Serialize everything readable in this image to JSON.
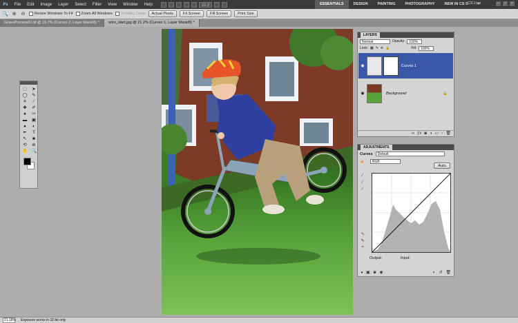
{
  "app": {
    "logo": "Ps",
    "menu": [
      "File",
      "Edit",
      "Image",
      "Layer",
      "Select",
      "Filter",
      "View",
      "Window",
      "Help"
    ],
    "zoom_select": "21.2",
    "workspaces": [
      "ESSENTIALS",
      "DESIGN",
      "PAINTING",
      "PHOTOGRAPHY",
      "NEW IN CS 5"
    ],
    "active_workspace": "ESSENTIALS",
    "cs_live": "CS Live",
    "more": "»"
  },
  "options": {
    "resize_windows": "Resize Windows To Fit",
    "zoom_all": "Zoom All Windows",
    "scrubby": "Scrubby Zoom",
    "buttons": [
      "Actual Pixels",
      "Fit Screen",
      "Fill Screen",
      "Print Size"
    ]
  },
  "tabs": [
    "GrassProcess01.tif @ 16.7% (Curves 2, Layer Mask/8) *",
    "retro_start.jpg @ 21.2% (Curves 1, Layer Mask/8) *"
  ],
  "layers_panel": {
    "title": "LAYERS",
    "blend_mode": "Normal",
    "opacity_label": "Opacity:",
    "opacity": "100%",
    "lock_label": "Lock:",
    "fill_label": "Fill:",
    "fill": "100%",
    "layers": [
      {
        "name": "Curves 1",
        "active": true
      },
      {
        "name": "Background",
        "active": false
      }
    ]
  },
  "adjustments_panel": {
    "title": "ADJUSTMENTS",
    "type_label": "Curves",
    "preset": "Default",
    "channel": "RGB",
    "auto_label": "Auto",
    "output_label": "Output:",
    "input_label": "Input:"
  },
  "status": {
    "zoom": "21.18%",
    "message": "Exposure works in 32-bit only"
  },
  "colors": {
    "accent": "#3a58a8",
    "foreground": "#000000",
    "background": "#ffffff"
  }
}
